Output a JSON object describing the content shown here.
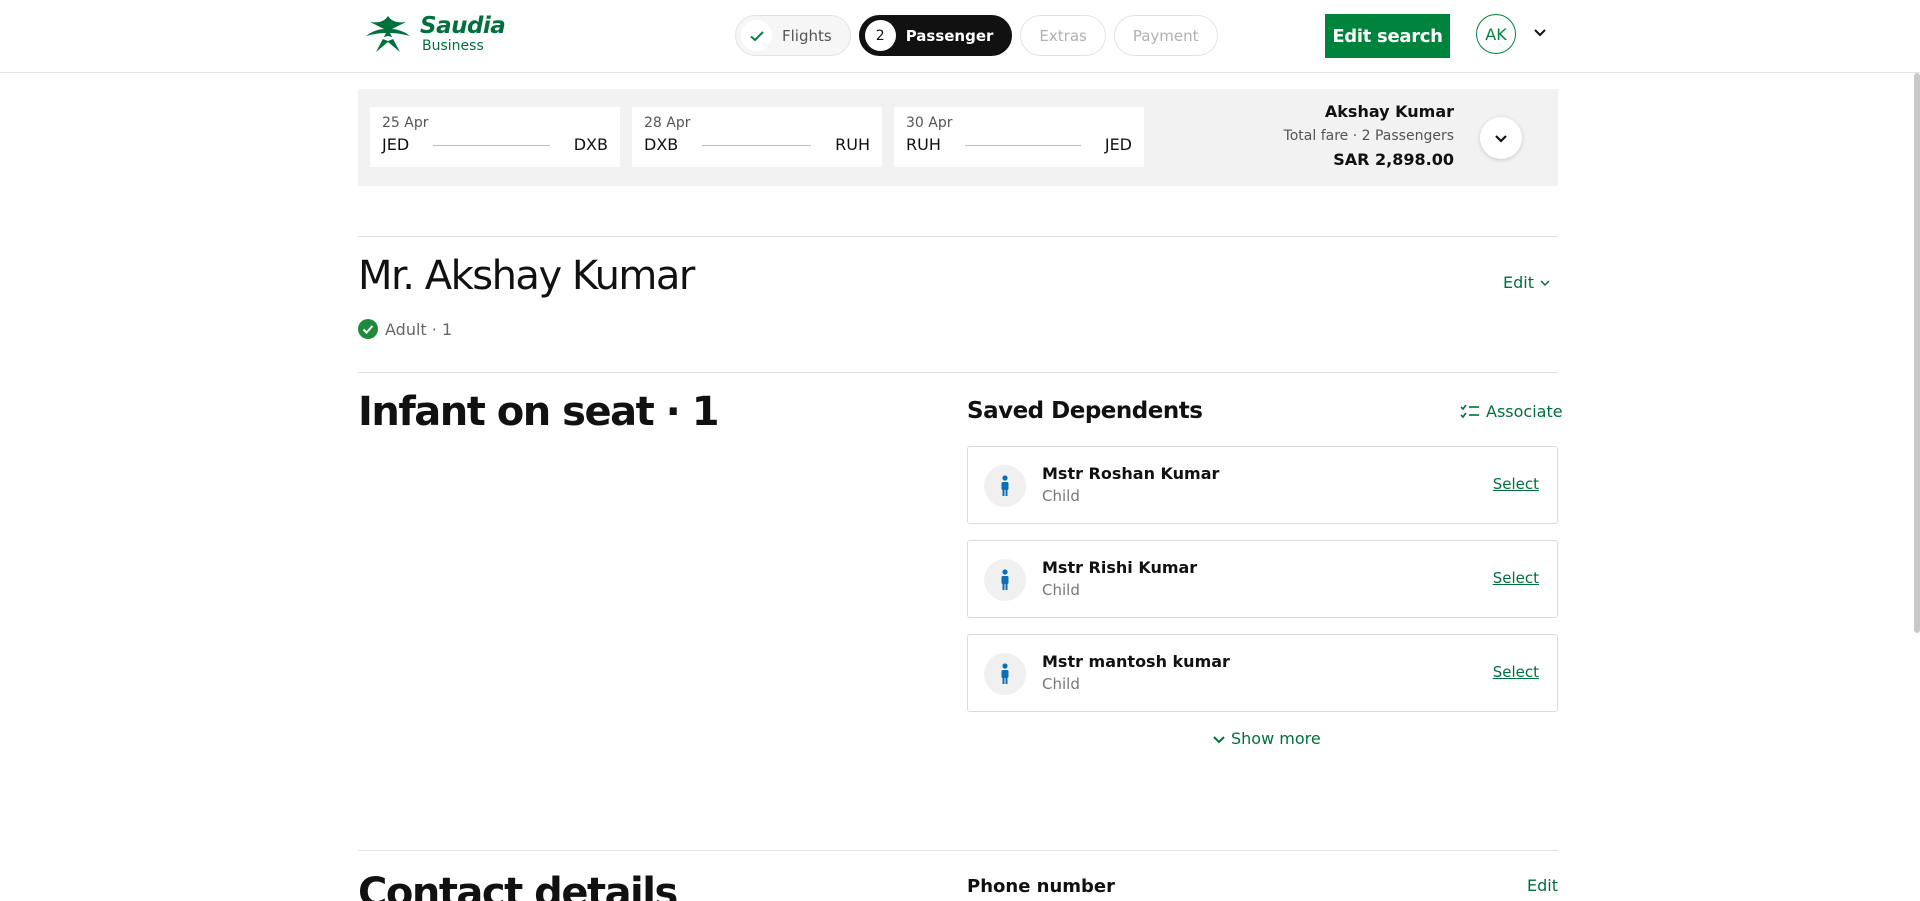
{
  "brand": {
    "name": "Saudia",
    "sub": "Business",
    "color": "#00703c"
  },
  "stepper": {
    "steps": [
      {
        "label": "Flights",
        "state": "done",
        "badge": "✓"
      },
      {
        "label": "Passenger",
        "state": "active",
        "badge": "2"
      },
      {
        "label": "Extras",
        "state": "todo"
      },
      {
        "label": "Payment",
        "state": "todo"
      }
    ]
  },
  "header": {
    "edit_search_label": "Edit search",
    "avatar_initials": "AK"
  },
  "itinerary": {
    "legs": [
      {
        "date": "25 Apr",
        "from": "JED",
        "to": "DXB"
      },
      {
        "date": "28 Apr",
        "from": "DXB",
        "to": "RUH"
      },
      {
        "date": "30 Apr",
        "from": "RUH",
        "to": "JED"
      }
    ],
    "fare": {
      "name": "Akshay Kumar",
      "label": "Total fare · 2 Passengers",
      "amount": "SAR 2,898.00"
    }
  },
  "passenger": {
    "name": "Mr. Akshay Kumar",
    "type": "Adult · 1",
    "edit_label": "Edit"
  },
  "infant": {
    "title": "Infant on seat · 1"
  },
  "dependents": {
    "title": "Saved Dependents",
    "associate_label": "Associate",
    "items": [
      {
        "name": "Mstr Roshan Kumar",
        "type": "Child",
        "action": "Select"
      },
      {
        "name": "Mstr Rishi Kumar",
        "type": "Child",
        "action": "Select"
      },
      {
        "name": "Mstr mantosh kumar",
        "type": "Child",
        "action": "Select"
      }
    ],
    "show_more_label": "Show more"
  },
  "contact": {
    "title": "Contact details",
    "phone_label": "Phone number",
    "edit_label": "Edit"
  },
  "colors": {
    "accent": "#00843d",
    "dark_step": "#111111",
    "person_icon": "#0a6fb5"
  }
}
